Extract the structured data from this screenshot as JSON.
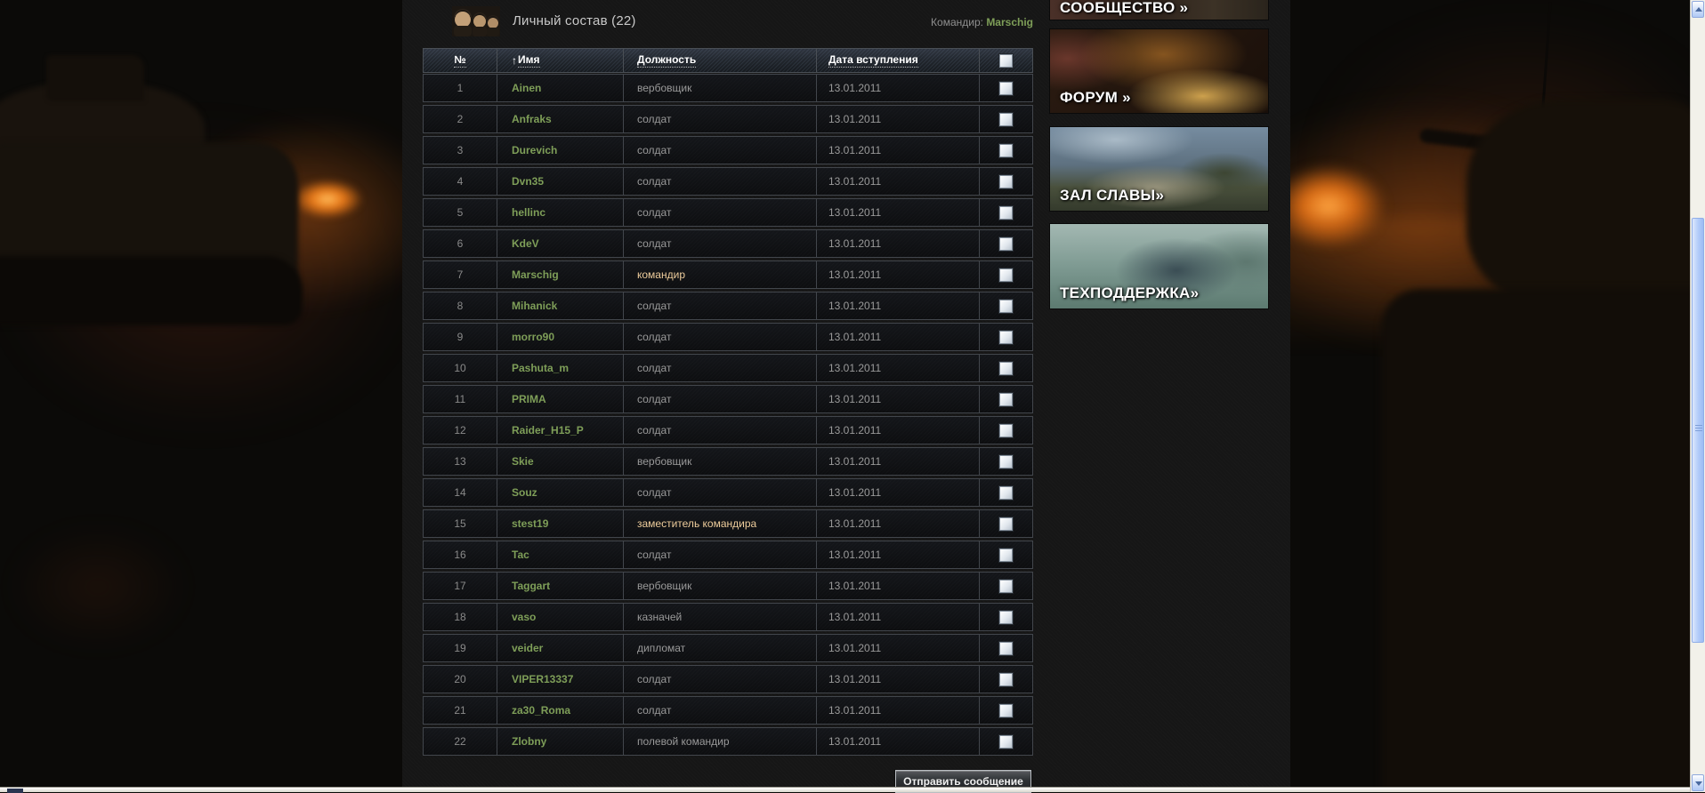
{
  "header": {
    "title": "Личный состав (22)",
    "commander_label": "Командир:",
    "commander_name": "Marschig"
  },
  "table": {
    "columns": {
      "num": "№",
      "name": "Имя",
      "role": "Должность",
      "date": "Дата вступления"
    },
    "sort": {
      "column": "Имя",
      "direction_icon": "↑"
    },
    "rows": [
      {
        "num": "1",
        "name": "Ainen",
        "role": "вербовщик",
        "date": "13.01.2011",
        "role_highlight": false
      },
      {
        "num": "2",
        "name": "Anfraks",
        "role": "солдат",
        "date": "13.01.2011",
        "role_highlight": false
      },
      {
        "num": "3",
        "name": "Durevich",
        "role": "солдат",
        "date": "13.01.2011",
        "role_highlight": false
      },
      {
        "num": "4",
        "name": "Dvn35",
        "role": "солдат",
        "date": "13.01.2011",
        "role_highlight": false
      },
      {
        "num": "5",
        "name": "hellinc",
        "role": "солдат",
        "date": "13.01.2011",
        "role_highlight": false
      },
      {
        "num": "6",
        "name": "KdeV",
        "role": "солдат",
        "date": "13.01.2011",
        "role_highlight": false
      },
      {
        "num": "7",
        "name": "Marschig",
        "role": "командир",
        "date": "13.01.2011",
        "role_highlight": true
      },
      {
        "num": "8",
        "name": "Mihanick",
        "role": "солдат",
        "date": "13.01.2011",
        "role_highlight": false
      },
      {
        "num": "9",
        "name": "morro90",
        "role": "солдат",
        "date": "13.01.2011",
        "role_highlight": false
      },
      {
        "num": "10",
        "name": "Pashuta_m",
        "role": "солдат",
        "date": "13.01.2011",
        "role_highlight": false
      },
      {
        "num": "11",
        "name": "PRIMA",
        "role": "солдат",
        "date": "13.01.2011",
        "role_highlight": false
      },
      {
        "num": "12",
        "name": "Raider_H15_P",
        "role": "солдат",
        "date": "13.01.2011",
        "role_highlight": false
      },
      {
        "num": "13",
        "name": "Skie",
        "role": "вербовщик",
        "date": "13.01.2011",
        "role_highlight": false
      },
      {
        "num": "14",
        "name": "Souz",
        "role": "солдат",
        "date": "13.01.2011",
        "role_highlight": false
      },
      {
        "num": "15",
        "name": "stest19",
        "role": "заместитель командира",
        "date": "13.01.2011",
        "role_highlight": true
      },
      {
        "num": "16",
        "name": "Tac",
        "role": "солдат",
        "date": "13.01.2011",
        "role_highlight": false
      },
      {
        "num": "17",
        "name": "Taggart",
        "role": "вербовщик",
        "date": "13.01.2011",
        "role_highlight": false
      },
      {
        "num": "18",
        "name": "vaso",
        "role": "казначей",
        "date": "13.01.2011",
        "role_highlight": false
      },
      {
        "num": "19",
        "name": "veider",
        "role": "дипломат",
        "date": "13.01.2011",
        "role_highlight": false
      },
      {
        "num": "20",
        "name": "VIPER13337",
        "role": "солдат",
        "date": "13.01.2011",
        "role_highlight": false
      },
      {
        "num": "21",
        "name": "za30_Roma",
        "role": "солдат",
        "date": "13.01.2011",
        "role_highlight": false
      },
      {
        "num": "22",
        "name": "Zlobny",
        "role": "полевой командир",
        "date": "13.01.2011",
        "role_highlight": false
      }
    ]
  },
  "actions": {
    "send_message_label": "Отправить сообщение"
  },
  "sidebar": {
    "banners": [
      {
        "id": "community",
        "label": "СООБЩЕСТВО »"
      },
      {
        "id": "forum",
        "label": "ФОРУМ »"
      },
      {
        "id": "hall-of-fame",
        "label": "ЗАЛ СЛАВЫ»"
      },
      {
        "id": "support",
        "label": "ТЕХПОДДЕРЖКА»"
      }
    ]
  },
  "colors": {
    "nickname_green": "#7e9e58",
    "role_highlight_tan": "#eecd9c",
    "role_gray": "#9a9a9a",
    "header_text": "#ffffff",
    "panel_bg": "#161616",
    "fire_orange": "#e87818"
  }
}
